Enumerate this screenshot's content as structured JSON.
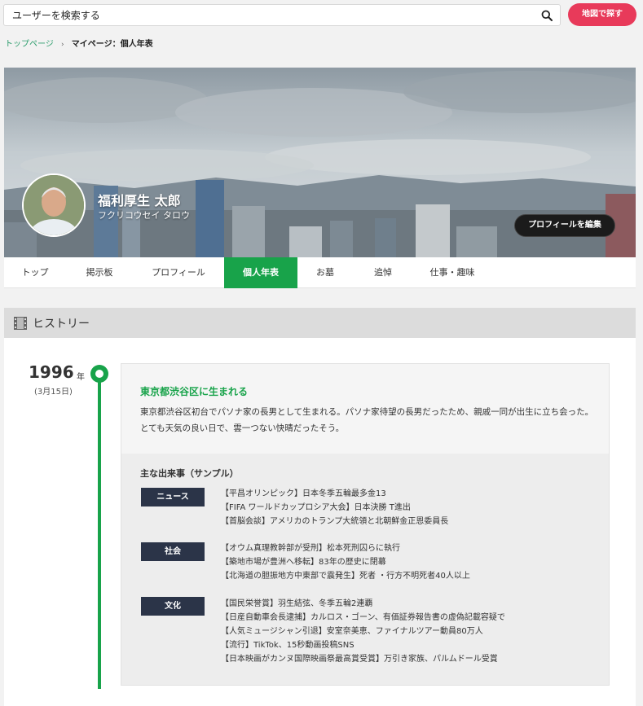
{
  "search": {
    "placeholder": "ユーザーを検索する"
  },
  "header": {
    "map_button": "地図で探す"
  },
  "breadcrumb": {
    "home": "トップページ",
    "separator": "›",
    "current": "マイページ：個人年表"
  },
  "profile": {
    "name": "福利厚生 太郎",
    "kana": "フクリコウセイ タロウ",
    "edit_button": "プロフィールを編集"
  },
  "tabs": [
    {
      "label": "トップ",
      "active": false
    },
    {
      "label": "掲示板",
      "active": false
    },
    {
      "label": "プロフィール",
      "active": false
    },
    {
      "label": "個人年表",
      "active": true
    },
    {
      "label": "お墓",
      "active": false
    },
    {
      "label": "追悼",
      "active": false
    },
    {
      "label": "仕事・趣味",
      "active": false
    }
  ],
  "history": {
    "title": "ヒストリー",
    "year": "1996",
    "year_unit": "年",
    "date": "(3月15日)",
    "event_title": "東京都渋谷区に生まれる",
    "event_desc": "東京都渋谷区初台でパソナ家の長男として生まれる。パソナ家待望の長男だったため、親戚一同が出生に立ち会った。とても天気の良い日で、雲一つない快晴だったそう。",
    "major_title": "主な出来事（サンプル）",
    "categories": [
      {
        "label": "ニュース",
        "items": [
          "【平昌オリンピック】日本冬季五輪最多金13",
          "【FIFA ワールドカップロシア大会】日本決勝 T進出",
          "【首脳会談】アメリカのトランプ大統領と北朝鮮金正恩委員長"
        ]
      },
      {
        "label": "社会",
        "items": [
          "【オウム真理教幹部が受刑】松本死刑囚らに執行",
          "【築地市場が豊洲へ移転】83年の歴史に閉幕",
          "【北海道の胆振地方中東部で震発生】死者 ・行方不明死者40人以上"
        ]
      },
      {
        "label": "文化",
        "items": [
          "【国民栄誉賞】羽生結弦、冬季五輪2連覇",
          "【日産自動車会長逮捕】カルロス・ゴーン、有価証券報告書の虚偽記載容疑で",
          "【人気ミュージシャン引退】安室奈美恵、ファイナルツアー動員80万人",
          "【流行】TikTok、15秒動画投稿SNS",
          "【日本映画がカンヌ国際映画祭最高賞受賞】万引き家族、パルムドール受賞"
        ]
      }
    ]
  },
  "colors": {
    "accent_green": "#18a34a",
    "map_button": "#e83a5a",
    "category_badge": "#2b3448"
  },
  "icons": {
    "search": "search-icon",
    "history": "film-strip-icon"
  }
}
